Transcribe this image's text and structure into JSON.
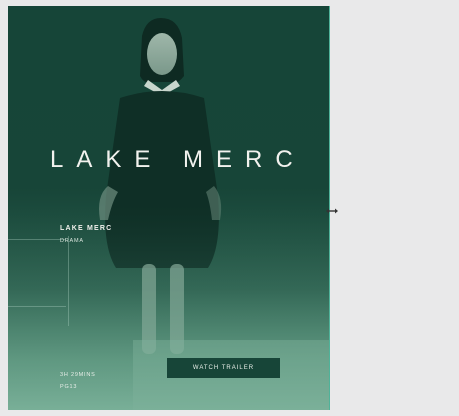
{
  "poster": {
    "title": "LAKE MERC",
    "subtitle": "LAKE MERC",
    "genre": "DRAMA",
    "runtime": "3H 29MINS",
    "rating": "PG13",
    "watch_label": "WATCH TRAILER"
  },
  "colors": {
    "background": "#164538",
    "accent": "#4fb39a",
    "button": "#174538"
  },
  "icons": {
    "resize": "resize-horizontal-icon"
  }
}
